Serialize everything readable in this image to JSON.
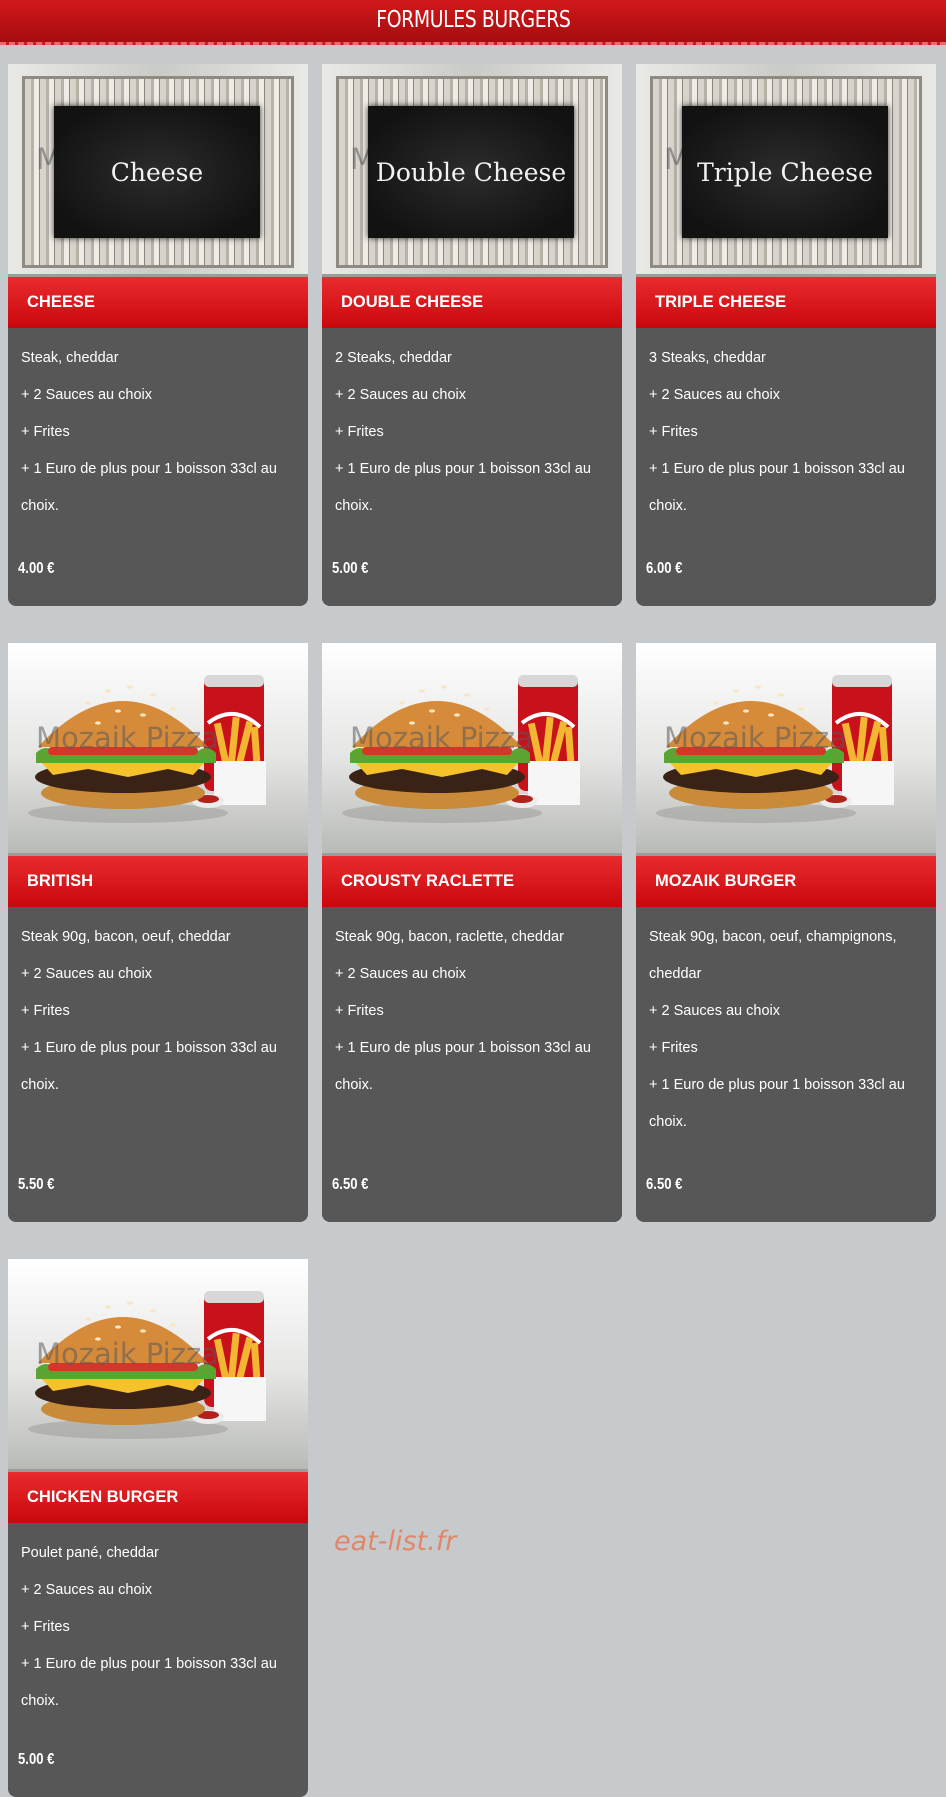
{
  "header": {
    "title": "FORMULES BURGERS"
  },
  "watermark": "Mozaik Pizza",
  "site_mark": "eat-list.fr",
  "colors": {
    "header_red": "#c01215",
    "card_dark": "#575757",
    "page_bg": "#c7cacc"
  },
  "cards": [
    {
      "image": "chalkboard",
      "chalk_text": "Cheese",
      "title": "CHEESE",
      "lines": [
        "Steak, cheddar",
        "+ 2 Sauces au choix",
        "+ Frites",
        "+ 1 Euro de plus pour 1 boisson 33cl au",
        "choix."
      ],
      "price": "4.00 €"
    },
    {
      "image": "chalkboard",
      "chalk_text": "Double Cheese",
      "title": "DOUBLE CHEESE",
      "lines": [
        "2 Steaks, cheddar",
        "+ 2 Sauces au choix",
        "+ Frites",
        "+ 1 Euro de plus pour 1 boisson 33cl au",
        "choix."
      ],
      "price": "5.00 €"
    },
    {
      "image": "chalkboard",
      "chalk_text": "Triple Cheese",
      "title": "TRIPLE CHEESE",
      "lines": [
        "3 Steaks, cheddar",
        "+ 2 Sauces au choix",
        "+ Frites",
        "+ 1 Euro de plus pour 1 boisson 33cl au",
        "choix."
      ],
      "price": "6.00 €"
    },
    {
      "image": "burger-photo",
      "title": "BRITISH",
      "lines": [
        "Steak 90g, bacon, oeuf, cheddar",
        "+ 2 Sauces au choix",
        "+ Frites",
        "+ 1 Euro de plus pour 1 boisson 33cl au",
        "choix."
      ],
      "price": "5.50 €"
    },
    {
      "image": "burger-photo",
      "title": "CROUSTY RACLETTE",
      "lines": [
        "Steak 90g, bacon, raclette, cheddar",
        "+ 2 Sauces au choix",
        "+ Frites",
        "+ 1 Euro de plus pour 1 boisson 33cl au",
        "choix."
      ],
      "price": "6.50 €"
    },
    {
      "image": "burger-photo",
      "title": "MOZAIK BURGER",
      "lines": [
        "Steak 90g, bacon, oeuf, champignons,",
        "cheddar",
        "+ 2 Sauces au choix",
        "+ Frites",
        "+ 1 Euro de plus pour 1 boisson 33cl au",
        "choix."
      ],
      "price": "6.50 €"
    },
    {
      "image": "burger-photo",
      "title": "CHICKEN BURGER",
      "lines": [
        "Poulet pané, cheddar",
        "+ 2 Sauces au choix",
        "+ Frites",
        "+ 1 Euro de plus pour 1 boisson 33cl au",
        "choix."
      ],
      "price": "5.00 €"
    }
  ]
}
